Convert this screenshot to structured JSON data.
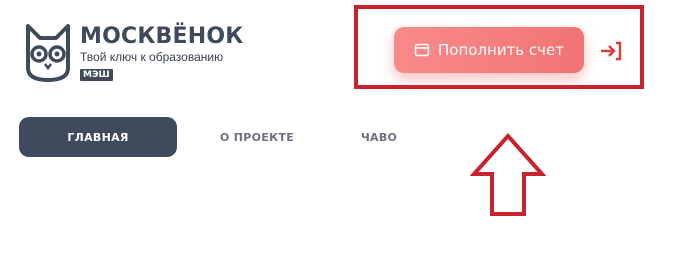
{
  "header": {
    "brand_name": "МОСКВЁНОК",
    "tagline": "Твой ключ к образованию",
    "badge": "МЭШ",
    "logo_icon": "owl-logo-icon"
  },
  "actions": {
    "topup_label": "Пополнить счет",
    "topup_icon": "wallet-icon",
    "login_icon": "login-arrow-icon"
  },
  "nav": {
    "tabs": [
      {
        "label": "ГЛАВНАЯ",
        "active": true
      },
      {
        "label": "О ПРОЕКТЕ",
        "active": false
      },
      {
        "label": "ЧАВО",
        "active": false
      }
    ]
  },
  "colors": {
    "brand_dark": "#3f4b5c",
    "accent_red": "#f27474",
    "highlight_red": "#c8222c",
    "inactive_tab": "#6b7280"
  }
}
